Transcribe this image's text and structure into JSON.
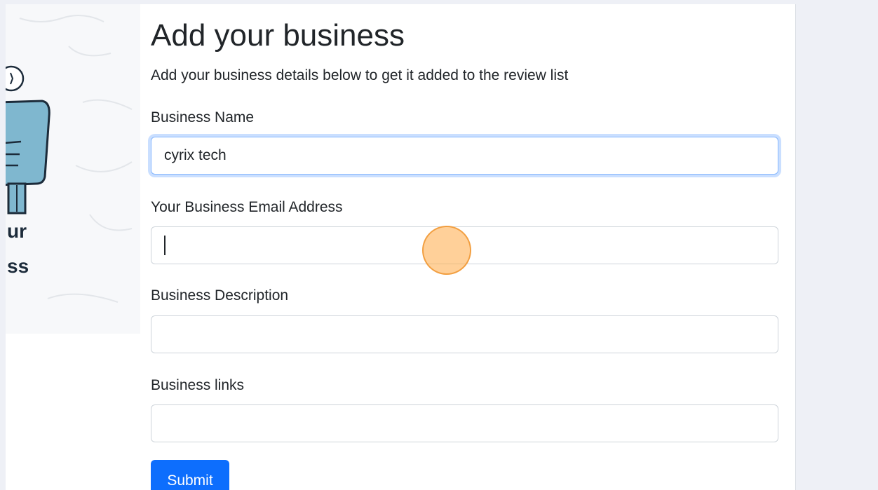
{
  "page": {
    "title": "Add your business",
    "subtitle": "Add your business details below to get it added to the review list"
  },
  "illustration": {
    "text_line1": "ur",
    "text_line2": "ss"
  },
  "form": {
    "business_name": {
      "label": "Business Name",
      "value": "cyrix tech",
      "placeholder": ""
    },
    "email": {
      "label": "Your Business Email Address",
      "value": "",
      "placeholder": ""
    },
    "description": {
      "label": "Business Description",
      "value": "",
      "placeholder": ""
    },
    "links": {
      "label": "Business links",
      "value": "",
      "placeholder": ""
    },
    "submit_label": "Submit"
  },
  "colors": {
    "primary": "#0d6efd",
    "focus_ring": "#86b7fe",
    "click_marker": "#ffaa46",
    "background": "#eef0f6"
  }
}
